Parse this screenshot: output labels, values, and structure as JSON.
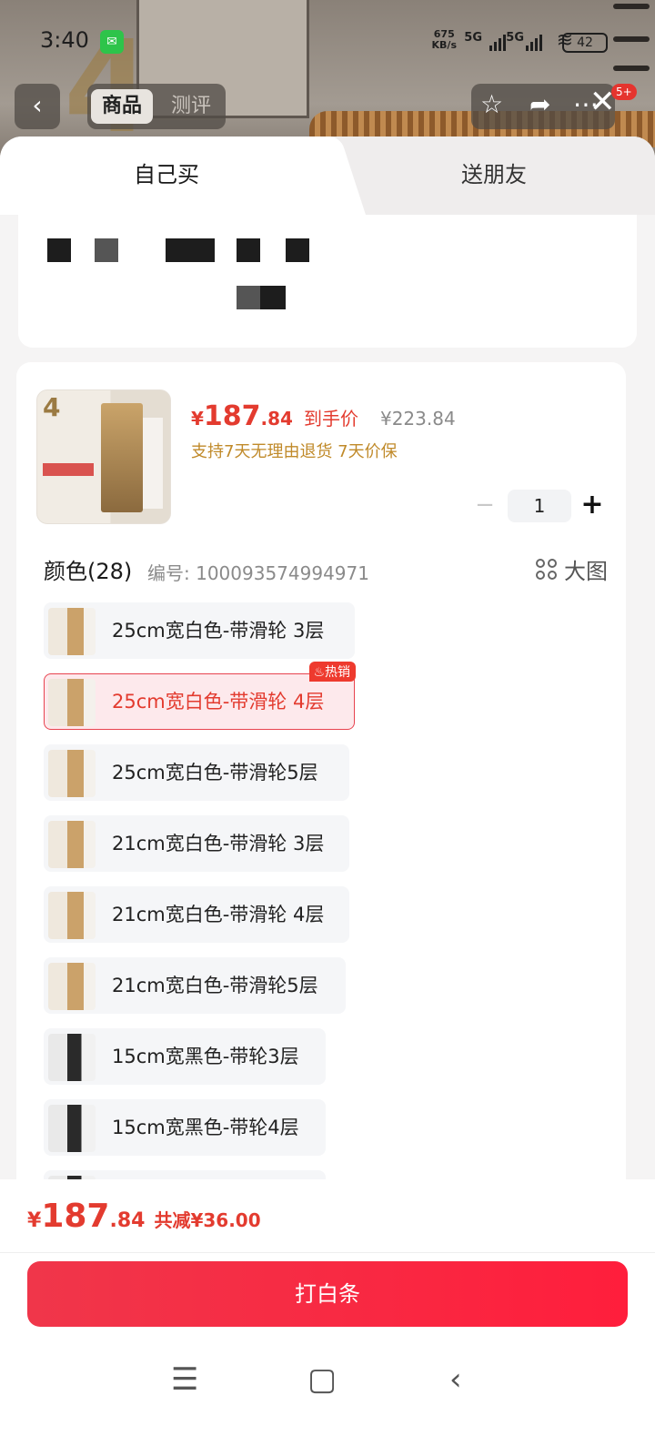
{
  "status_bar": {
    "time": "3:40",
    "net_speed": "675\nKB/s",
    "net_speed_top": "675",
    "net_speed_bottom": "KB/s",
    "sim1": "5G",
    "sim2": "5G",
    "battery": "42"
  },
  "top_nav": {
    "tab_product": "商品",
    "tab_review": "测评",
    "badge": "5+"
  },
  "sheet_tabs": {
    "self": "自己买",
    "friend": "送朋友"
  },
  "product": {
    "price_int": "187",
    "price_dec": ".84",
    "price_label": "到手价",
    "original_price": "¥223.84",
    "currency": "¥",
    "policy": "支持7天无理由退货 7天价保",
    "thumb_number": "4",
    "quantity": "1",
    "minus": "−",
    "plus": "+"
  },
  "color_section": {
    "title": "颜色(28)",
    "sku": "编号: 100093574994971",
    "big_view": "大图",
    "hot_tag": "热销",
    "options": [
      {
        "label": "25cm宽白色-带滑轮 3层",
        "selected": false
      },
      {
        "label": "25cm宽白色-带滑轮 4层",
        "selected": true
      },
      {
        "label": "25cm宽白色-带滑轮5层",
        "selected": false
      },
      {
        "label": "21cm宽白色-带滑轮 3层",
        "selected": false
      },
      {
        "label": "21cm宽白色-带滑轮 4层",
        "selected": false
      },
      {
        "label": "21cm宽白色-带滑轮5层",
        "selected": false
      },
      {
        "label": "15cm宽黑色-带轮3层",
        "selected": false
      },
      {
        "label": "15cm宽黑色-带轮4层",
        "selected": false
      }
    ]
  },
  "footer": {
    "currency": "¥",
    "total_int": "187",
    "total_dec": ".84",
    "saving": "共减¥36.00",
    "pay_button": "打白条"
  },
  "colors": {
    "accent": "#e33b2f",
    "button": "#f0364a",
    "policy": "#c08a2a"
  }
}
